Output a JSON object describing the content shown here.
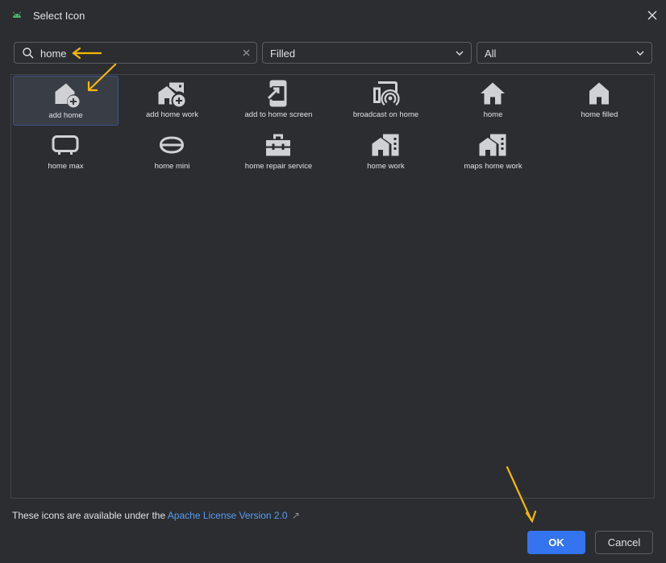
{
  "window": {
    "title": "Select Icon"
  },
  "search": {
    "value": "home",
    "placeholder": ""
  },
  "filters": {
    "style_value": "Filled",
    "category_value": "All"
  },
  "icons": [
    {
      "label": "add home",
      "icon": "add-home",
      "selected": true
    },
    {
      "label": "add home work",
      "icon": "add-home-work",
      "selected": false
    },
    {
      "label": "add to home screen",
      "icon": "add-to-home-screen",
      "selected": false
    },
    {
      "label": "broadcast on home",
      "icon": "broadcast-on-home",
      "selected": false
    },
    {
      "label": "home",
      "icon": "home",
      "selected": false
    },
    {
      "label": "home filled",
      "icon": "home-filled",
      "selected": false
    },
    {
      "label": "home max",
      "icon": "home-max",
      "selected": false
    },
    {
      "label": "home mini",
      "icon": "home-mini",
      "selected": false
    },
    {
      "label": "home repair service",
      "icon": "home-repair-service",
      "selected": false
    },
    {
      "label": "home work",
      "icon": "home-work",
      "selected": false
    },
    {
      "label": "maps home work",
      "icon": "maps-home-work",
      "selected": false
    }
  ],
  "footer": {
    "license_text": "These icons are available under the",
    "license_link": "Apache License Version 2.0",
    "license_link_icon": "↗",
    "ok_label": "OK",
    "cancel_label": "Cancel"
  },
  "colors": {
    "accent": "#3574f0",
    "link": "#589df6",
    "annotation": "#f5b800",
    "icon_fill": "#cfd1d4"
  }
}
